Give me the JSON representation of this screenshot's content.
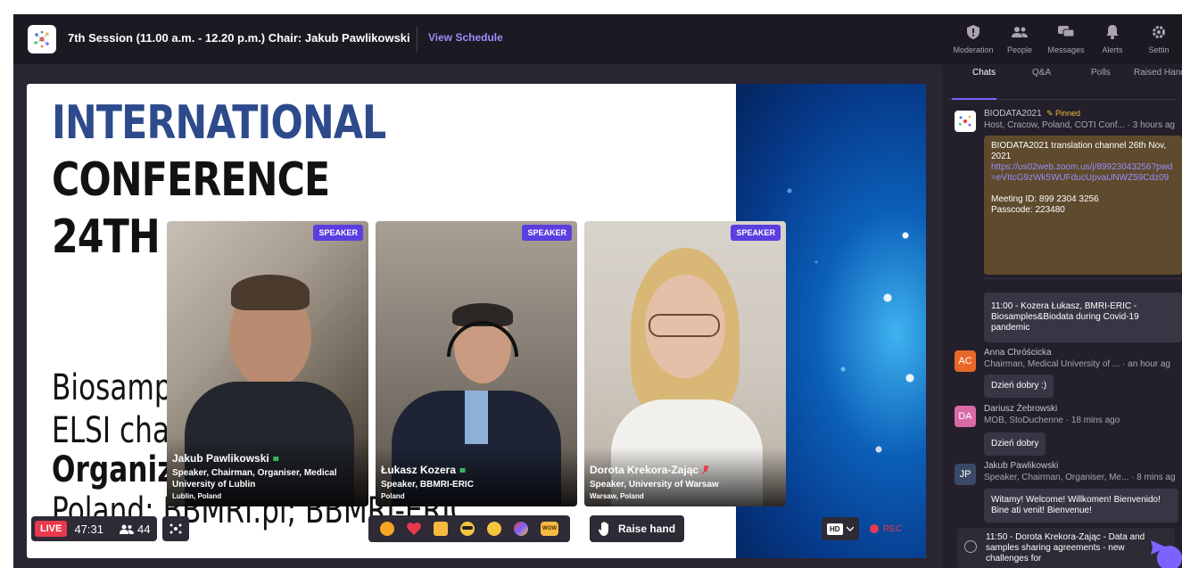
{
  "header": {
    "session_title": "7th Session (11.00 a.m. - 12.20 p.m.) Chair: Jakub Pawlikowski",
    "view_schedule": "View Schedule"
  },
  "nav": [
    {
      "label": "Moderation",
      "icon": "shield-icon"
    },
    {
      "label": "People",
      "icon": "people-icon"
    },
    {
      "label": "Messages",
      "icon": "messages-icon"
    },
    {
      "label": "Alerts",
      "icon": "bell-icon"
    },
    {
      "label": "Settin",
      "icon": "gear-icon"
    }
  ],
  "slide": {
    "line1": "INTERNATIONAL",
    "line2": "CONFERENCE",
    "line3": "24TH",
    "line4": "Biosamp",
    "line5": "ELSI cha",
    "line6": "Organiz",
    "line7": "Poland: BBMRI.pl; BBMRI-ERIC"
  },
  "speakers": [
    {
      "badge": "SPEAKER",
      "name": "Jakub Pawlikowski",
      "role": "Speaker, Chairman, Organiser, Medical University of Lublin",
      "location": "Lublin, Poland",
      "mic": "on"
    },
    {
      "badge": "SPEAKER",
      "name": "Łukasz Kozera",
      "role": "Speaker, BBMRI-ERIC",
      "location": "Poland",
      "mic": "on"
    },
    {
      "badge": "SPEAKER",
      "name": "Dorota Krekora-Zając",
      "role": "Speaker, University of Warsaw",
      "location": "Warsaw, Poland",
      "mic": "muted"
    }
  ],
  "controls": {
    "live": "LIVE",
    "time": "47:31",
    "viewers": "44",
    "raise_hand": "Raise hand",
    "hd": "HD",
    "rec": "REC"
  },
  "panel": {
    "tabs": [
      "Chats",
      "Q&A",
      "Polls",
      "Raised Hands"
    ],
    "active_tab": "Chats",
    "pinned": {
      "name": "BIODATA2021",
      "pinned_label": "Pinned",
      "sub": "Host, Cracow, Poland, COTI Conf...",
      "time": "3 hours ag",
      "text": "BIODATA2021 translation channel 26th Nov, 2021",
      "link": "https://us02web.zoom.us/j/89923043256?pwd=eVItcG9zWk5WUFducUpvaUNWZ59Cdz09",
      "meeting_id": "Meeting ID: 899 2304 3256",
      "passcode": "Passcode: 223480"
    },
    "agenda_bubble": "11:00 - Kozera Łukasz, BMRI-ERIC - Biosamples&Biodata during Covid-19 pandemic",
    "messages": [
      {
        "initials": "AC",
        "color": "#e8682a",
        "name": "Anna Chróścicka",
        "sub": "Chairman, Medical University of ...",
        "time": "an hour ag",
        "text": "Dzień dobry :)"
      },
      {
        "initials": "DA",
        "color": "#d86aa6",
        "name": "Dariusz Żebrowski",
        "sub": "MOB, StoDuchenne",
        "time": "18 mins ago",
        "text": "Dzień dobry"
      },
      {
        "initials": "JP",
        "color": "#3a4a66",
        "name": "Jakub Pawlikowski",
        "sub": "Speaker, Chairman, Organiser, Me...",
        "time": "8 mins ag",
        "text": "Witamy! Welcome! Willkomen! Bienvenido! Bine ati venit! Bienvenue!"
      }
    ],
    "composer_text": "11:50 - Dorota Krekora-Zając - Data and samples sharing agreements - new challenges for"
  },
  "colors": {
    "accent": "#7b63ff",
    "live": "#e8394d",
    "speaker_badge": "#5b3ee0",
    "pinned": "#f5b942"
  }
}
